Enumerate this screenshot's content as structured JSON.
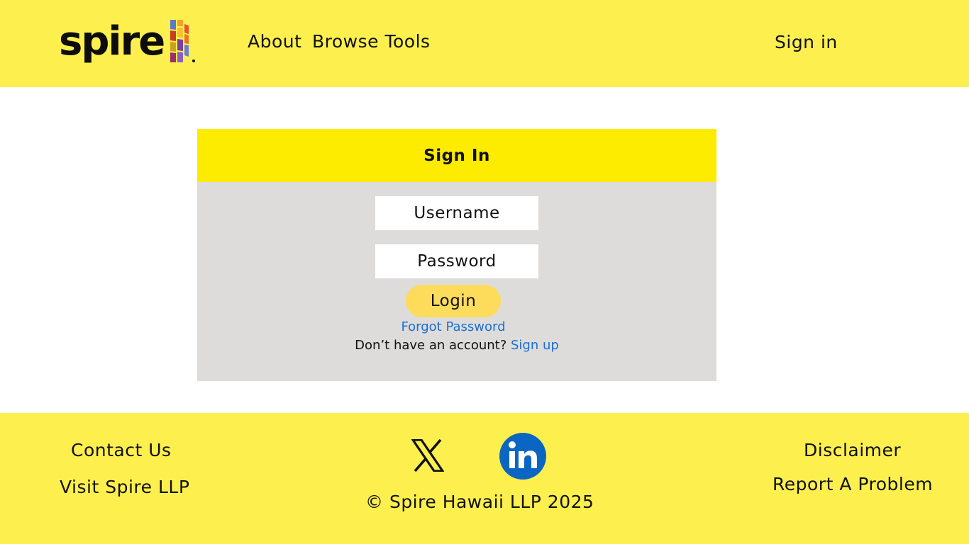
{
  "header": {
    "logo_text": "spire",
    "nav": {
      "about": "About",
      "browse_tools": "Browse Tools",
      "sign_in": "Sign in"
    }
  },
  "signin_card": {
    "title": "Sign In",
    "username_placeholder": "Username",
    "password_placeholder": "Password",
    "login_label": "Login",
    "forgot_password": "Forgot Password",
    "no_account_text": "Don’t have an account?",
    "signup_link": "Sign up"
  },
  "footer": {
    "contact_us": "Contact Us",
    "visit_spire": "Visit Spire LLP",
    "disclaimer": "Disclaimer",
    "report_problem": "Report A Problem",
    "copyright": "© Spire Hawaii LLP 2025",
    "social": [
      {
        "icon": "x-logo-icon"
      },
      {
        "icon": "linkedin-icon"
      }
    ]
  },
  "colors": {
    "header_footer_bg": "#fdf04e",
    "card_header_bg": "#fdeb00",
    "card_body_bg": "#dddcdb",
    "login_button": "#fcdc5a",
    "link_blue": "#1b6fd2",
    "linkedin_blue": "#0a66c2"
  }
}
